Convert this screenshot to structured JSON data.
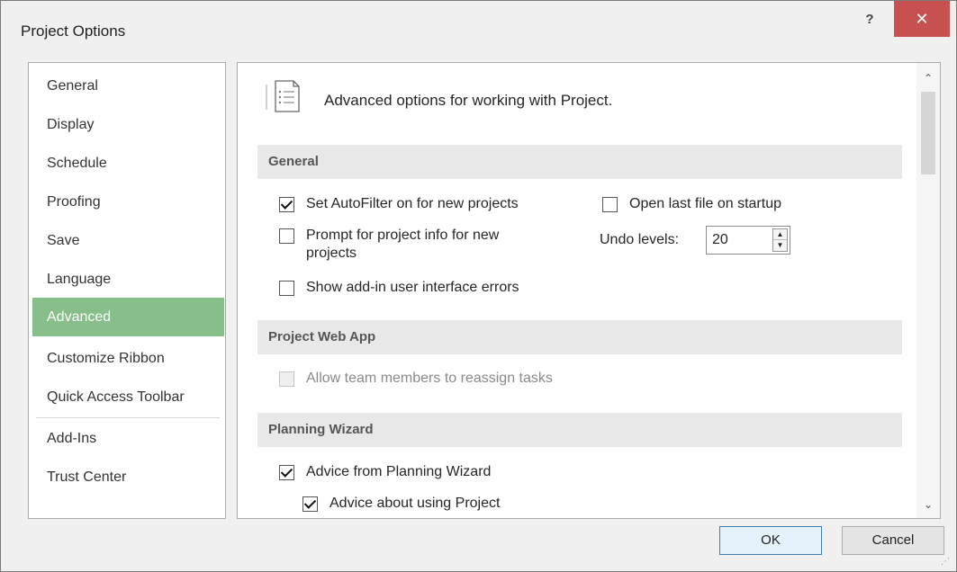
{
  "window": {
    "title": "Project Options",
    "help_label": "?",
    "close_label": "✕"
  },
  "sidebar": {
    "items": [
      {
        "label": "General"
      },
      {
        "label": "Display"
      },
      {
        "label": "Schedule"
      },
      {
        "label": "Proofing"
      },
      {
        "label": "Save"
      },
      {
        "label": "Language"
      },
      {
        "label": "Advanced",
        "active": true
      },
      {
        "label": "Customize Ribbon"
      },
      {
        "label": "Quick Access Toolbar"
      },
      {
        "label": "Add-Ins"
      },
      {
        "label": "Trust Center"
      }
    ]
  },
  "content": {
    "heading": "Advanced options for working with Project.",
    "heading_icon": "document-options-icon",
    "sections": {
      "general": {
        "title": "General",
        "set_autofilter": {
          "label": "Set AutoFilter on for new projects",
          "checked": true
        },
        "open_last_file": {
          "label": "Open last file on startup",
          "checked": false
        },
        "prompt_project_info": {
          "label_line1": "Prompt for project info for new",
          "label_line2": "projects",
          "checked": false
        },
        "show_addin_errors": {
          "label": "Show add-in user interface errors",
          "checked": false
        },
        "undo_levels": {
          "label": "Undo levels:",
          "value": "20"
        }
      },
      "project_web_app": {
        "title": "Project Web App",
        "allow_reassign": {
          "label": "Allow team members to reassign tasks",
          "checked": false,
          "disabled": true
        }
      },
      "planning_wizard": {
        "title": "Planning Wizard",
        "advice_from_wizard": {
          "label": "Advice from Planning Wizard",
          "checked": true
        },
        "advice_about_project": {
          "label": "Advice about using Project",
          "checked": true
        }
      }
    }
  },
  "buttons": {
    "ok": "OK",
    "cancel": "Cancel"
  },
  "colors": {
    "active_nav": "#86bf8a",
    "close_button": "#c75050",
    "section_header": "#e8e8e8"
  }
}
